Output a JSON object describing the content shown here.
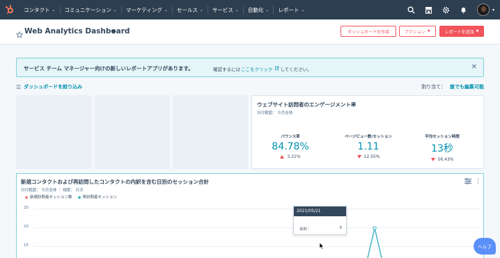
{
  "nav": {
    "items": [
      {
        "label": "コンタクト",
        "icon": "chevron-down-icon"
      },
      {
        "label": "コミュニケーション",
        "icon": "chevron-down-icon"
      },
      {
        "label": "マーケティング",
        "icon": "chevron-down-icon"
      },
      {
        "label": "セールス",
        "icon": "chevron-down-icon"
      },
      {
        "label": "サービス",
        "icon": "chevron-down-icon"
      },
      {
        "label": "自動化",
        "icon": "chevron-down-icon"
      },
      {
        "label": "レポート",
        "icon": "chevron-down-icon"
      }
    ],
    "right_icons": [
      "search-icon",
      "marketplace-icon",
      "gear-icon",
      "bell-icon",
      "avatar"
    ]
  },
  "header": {
    "title": "Web Analytics Dashboard",
    "btn_create": "ダッシュボードを作成",
    "btn_actions": "アクション",
    "btn_add": "レポートを追加"
  },
  "banner": {
    "main": "サービス チーム マネージャー向けの新しいレポートアプリがあります。",
    "sub_before": "確認するには",
    "link": "ここをクリック",
    "sub_after": "してください。"
  },
  "filter": {
    "label": "ダッシュボードを絞り込み"
  },
  "assign": {
    "label": "割り当て：",
    "value": "誰でも編集可能"
  },
  "engagement": {
    "title": "ウェブサイト訪問者のエンゲージメント率",
    "date": "日付範囲： 今月全体",
    "metrics": [
      {
        "label": "バウンス率",
        "value": "84.78%",
        "delta": "3.21%",
        "direction": "up"
      },
      {
        "label": "ページビュー数/セッション",
        "value": "1.11",
        "delta": "12.55%",
        "direction": "down"
      },
      {
        "label": "平均セッション時間",
        "value": "13秒",
        "delta": "56.43%",
        "direction": "down"
      }
    ]
  },
  "sessions": {
    "title": "新規コンタクトおよび再訪問したコンタクトの内訳を含む日別のセッション合計",
    "sub": "日付範囲： 今月全体 ｜ 頻度： 日次",
    "legend": [
      {
        "label": "新規訪問者セッション数",
        "color": "#e8877f"
      },
      {
        "label": "再訪問者セッション",
        "color": "#4fb8c9"
      }
    ],
    "yticks": [
      "25",
      "20",
      "15"
    ],
    "tooltip": {
      "date": "2021/05/21",
      "label": "合計：",
      "value": "0"
    }
  },
  "help": {
    "label": "ヘルプ"
  },
  "colors": {
    "accent": "#0091ae",
    "danger": "#f2545b",
    "nav": "#2d3e50"
  }
}
